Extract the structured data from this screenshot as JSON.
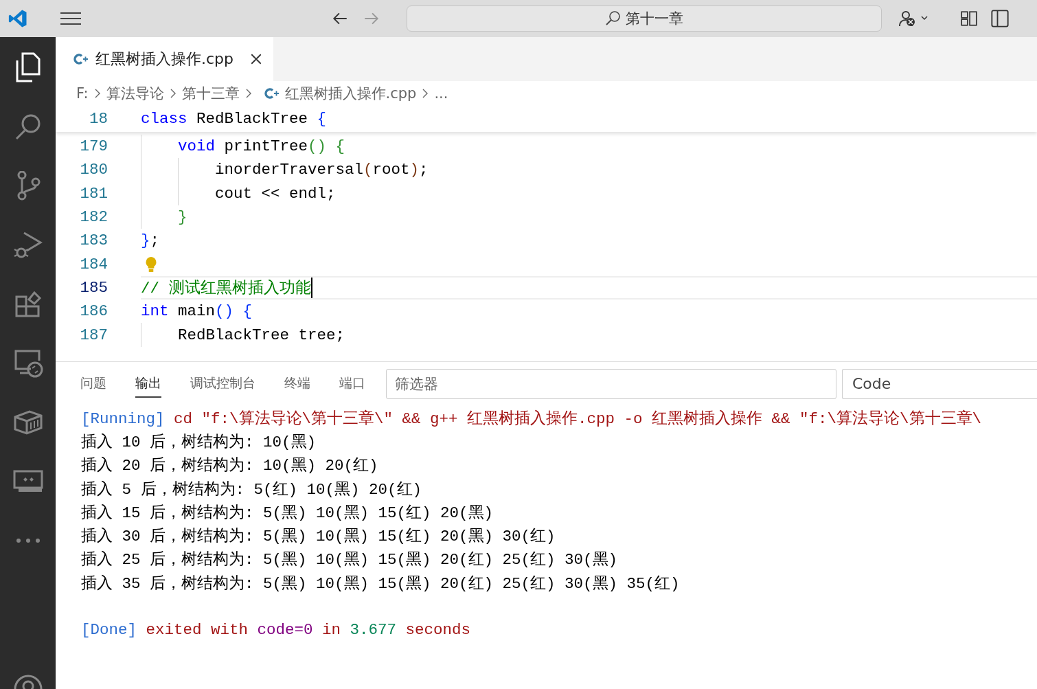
{
  "title_bar": {
    "search": "第十一章"
  },
  "activity_bar": {
    "items": [
      {
        "kind": "explorer",
        "selected": true
      },
      {
        "kind": "search",
        "selected": false
      },
      {
        "kind": "source-control",
        "selected": false
      },
      {
        "kind": "run-debug",
        "selected": false
      },
      {
        "kind": "extensions",
        "selected": false
      },
      {
        "kind": "remote",
        "selected": false
      },
      {
        "kind": "containers",
        "selected": false
      },
      {
        "kind": "pairing",
        "selected": false
      },
      {
        "kind": "more",
        "selected": false
      }
    ]
  },
  "tabs": [
    {
      "label": "红黑树插入操作.cpp",
      "selected": true
    }
  ],
  "breadcrumb": [
    "F:",
    "算法导论",
    "第十三章",
    "红黑树插入操作.cpp",
    "..."
  ],
  "sticky_line": {
    "number": "18",
    "tokens": [
      {
        "kind": "kw",
        "text": "class"
      },
      {
        "kind": "text",
        "text": " RedBlackTree"
      },
      {
        "kind": "b1",
        "text": " {"
      }
    ]
  },
  "code_lines": [
    {
      "number": "179",
      "current": false,
      "lightbulb": false,
      "tokens": [
        {
          "kind": "kw",
          "text": "    void"
        },
        {
          "kind": "text",
          "text": " printTree"
        },
        {
          "kind": "b2",
          "text": "()"
        },
        {
          "kind": "b2",
          "text": " {"
        }
      ]
    },
    {
      "number": "180",
      "current": false,
      "lightbulb": false,
      "tokens": [
        {
          "kind": "text",
          "text": "        inorderTraversal"
        },
        {
          "kind": "b3",
          "text": "("
        },
        {
          "kind": "text",
          "text": "root"
        },
        {
          "kind": "b3",
          "text": ")"
        },
        {
          "kind": "text",
          "text": ";"
        }
      ]
    },
    {
      "number": "181",
      "current": false,
      "lightbulb": false,
      "tokens": [
        {
          "kind": "text",
          "text": "        cout << endl;"
        }
      ]
    },
    {
      "number": "182",
      "current": false,
      "lightbulb": false,
      "tokens": [
        {
          "kind": "b2",
          "text": "    }"
        }
      ]
    },
    {
      "number": "183",
      "current": false,
      "lightbulb": false,
      "tokens": [
        {
          "kind": "b1",
          "text": "}"
        },
        {
          "kind": "text",
          "text": ";"
        }
      ]
    },
    {
      "number": "184",
      "current": false,
      "lightbulb": true
    },
    {
      "number": "185",
      "current": true,
      "lightbulb": false,
      "tokens": [
        {
          "kind": "comment",
          "text": "// 测试红黑树插入功能"
        }
      ]
    },
    {
      "number": "186",
      "current": false,
      "lightbulb": false,
      "tokens": [
        {
          "kind": "kw",
          "text": "int"
        },
        {
          "kind": "text",
          "text": " main"
        },
        {
          "kind": "b1",
          "text": "()"
        },
        {
          "kind": "b1",
          "text": " {"
        }
      ]
    },
    {
      "number": "187",
      "current": false,
      "lightbulb": false,
      "tokens": [
        {
          "kind": "text",
          "text": "    RedBlackTree tree;"
        }
      ]
    }
  ],
  "panel": {
    "tabs": [
      {
        "label": "问题",
        "selected": false
      },
      {
        "label": "输出",
        "selected": true
      },
      {
        "label": "调试控制台",
        "selected": false
      },
      {
        "label": "终端",
        "selected": false
      },
      {
        "label": "端口",
        "selected": false
      }
    ],
    "filter": {
      "placeholder": "筛选器"
    },
    "channel": "Code",
    "output": [
      {
        "gap_before": false,
        "tokens": [
          {
            "kind": "tag",
            "text": "[Running]"
          },
          {
            "kind": "str",
            "text": " cd \"f:\\算法导论\\第十三章\\\" && g++ 红黑树插入操作.cpp -o 红黑树插入操作 && \"f:\\算法导论\\第十三章\\"
          }
        ]
      },
      {
        "gap_before": false,
        "tokens": [
          {
            "kind": "text",
            "text": "插入 10 后，树结构为: 10(黑)"
          }
        ]
      },
      {
        "gap_before": false,
        "tokens": [
          {
            "kind": "text",
            "text": "插入 20 后，树结构为: 10(黑) 20(红)"
          }
        ]
      },
      {
        "gap_before": false,
        "tokens": [
          {
            "kind": "text",
            "text": "插入 5 后，树结构为: 5(红) 10(黑) 20(红)"
          }
        ]
      },
      {
        "gap_before": false,
        "tokens": [
          {
            "kind": "text",
            "text": "插入 15 后，树结构为: 5(黑) 10(黑) 15(红) 20(黑)"
          }
        ]
      },
      {
        "gap_before": false,
        "tokens": [
          {
            "kind": "text",
            "text": "插入 30 后，树结构为: 5(黑) 10(黑) 15(红) 20(黑) 30(红)"
          }
        ]
      },
      {
        "gap_before": false,
        "tokens": [
          {
            "kind": "text",
            "text": "插入 25 后，树结构为: 5(黑) 10(黑) 15(黑) 20(红) 25(红) 30(黑)"
          }
        ]
      },
      {
        "gap_before": false,
        "tokens": [
          {
            "kind": "text",
            "text": "插入 35 后，树结构为: 5(黑) 10(黑) 15(黑) 20(红) 25(红) 30(黑) 35(红)"
          }
        ]
      },
      {
        "gap_before": true,
        "tokens": [
          {
            "kind": "tag",
            "text": "[Done]"
          },
          {
            "kind": "str",
            "text": " exited with "
          },
          {
            "kind": "var",
            "text": "code=0"
          },
          {
            "kind": "str",
            "text": " in "
          },
          {
            "kind": "num",
            "text": "3.677"
          },
          {
            "kind": "str",
            "text": " seconds"
          }
        ]
      }
    ]
  }
}
